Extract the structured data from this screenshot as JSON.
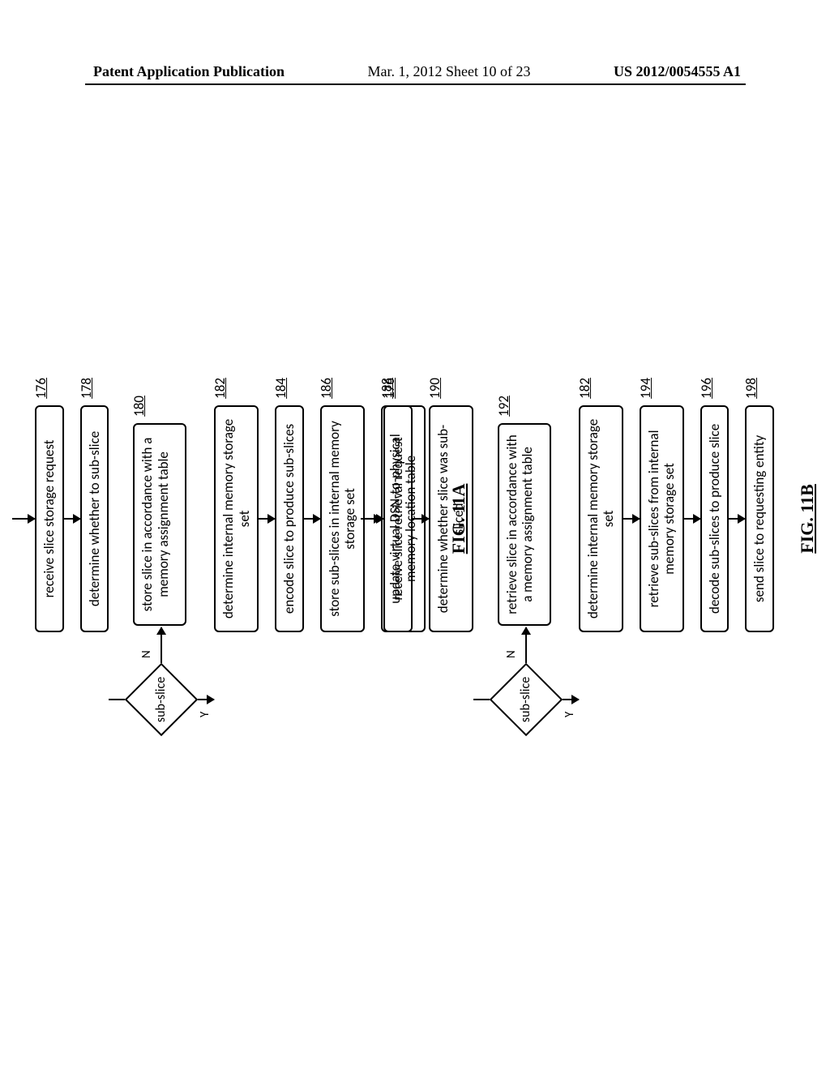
{
  "header": {
    "left": "Patent Application Publication",
    "mid": "Mar. 1, 2012  Sheet 10 of 23",
    "right": "US 2012/0054555 A1"
  },
  "fig_a": {
    "label": "FIG. 11A",
    "ref_top": "176",
    "steps": [
      {
        "ref": "176",
        "text": "receive slice storage request"
      },
      {
        "ref": "178",
        "text": "determine whether to sub-slice"
      }
    ],
    "decision": {
      "label": "sub-slice",
      "n": "N",
      "y": "Y",
      "side_ref": "180",
      "side_text": "store slice in accordance with a memory assignment table"
    },
    "cont": [
      {
        "ref": "182",
        "text": "determine internal memory storage set"
      },
      {
        "ref": "184",
        "text": "encode slice to produce sub-slices"
      },
      {
        "ref": "186",
        "text": "store sub-slices in internal memory storage set"
      },
      {
        "ref": "188",
        "text": "update virtual DSN-to-physical memory location table"
      }
    ]
  },
  "fig_b": {
    "label": "FIG. 11B",
    "ref_top": "176",
    "steps": [
      {
        "ref": "176",
        "text": "receive slice retrieval request"
      },
      {
        "ref": "190",
        "text": "determine whether slice was sub-sliced"
      }
    ],
    "decision": {
      "label": "sub-slice",
      "n": "N",
      "y": "Y",
      "side_ref": "192",
      "side_text": "retrieve slice in accordance with a memory assignment table"
    },
    "cont": [
      {
        "ref": "182",
        "text": "determine internal memory storage set"
      },
      {
        "ref": "194",
        "text": "retrieve sub-slices from internal memory storage set"
      },
      {
        "ref": "196",
        "text": "decode sub-slices to produce slice"
      },
      {
        "ref": "198",
        "text": "send slice to requesting entity"
      }
    ]
  }
}
